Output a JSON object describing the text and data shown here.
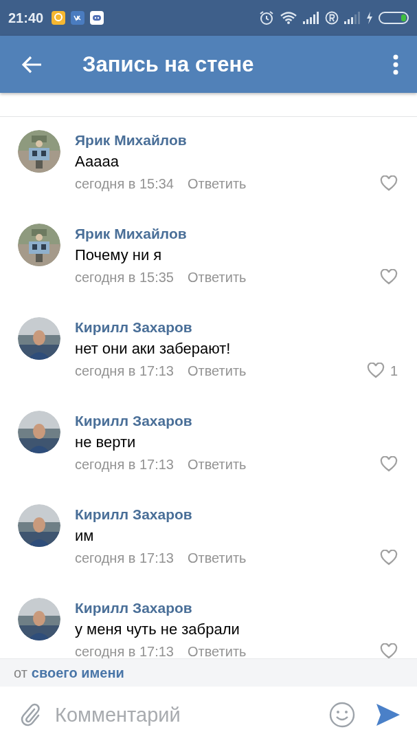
{
  "status_bar": {
    "time": "21:40"
  },
  "header": {
    "title": "Запись на стене"
  },
  "comments": [
    {
      "author": "Ярик Михайлов",
      "text": "Ааааа",
      "time": "сегодня в 15:34",
      "reply": "Ответить"
    },
    {
      "author": "Ярик Михайлов",
      "text": "Почему ни я",
      "time": "сегодня в 15:35",
      "reply": "Ответить"
    },
    {
      "author": "Кирилл Захаров",
      "text": "нет они аки заберают!",
      "time": "сегодня в 17:13",
      "reply": "Ответить",
      "likes": "1"
    },
    {
      "author": "Кирилл Захаров",
      "text": "не верти",
      "time": "сегодня в 17:13",
      "reply": "Ответить"
    },
    {
      "author": "Кирилл Захаров",
      "text": "им",
      "time": "сегодня в 17:13",
      "reply": "Ответить"
    },
    {
      "author": "Кирилл Захаров",
      "text": "у меня чуть не забрали",
      "time": "сегодня в 17:13",
      "reply": "Ответить"
    }
  ],
  "sender": {
    "prefix": "от",
    "link": "своего имени"
  },
  "composer": {
    "placeholder": "Комментарий"
  }
}
